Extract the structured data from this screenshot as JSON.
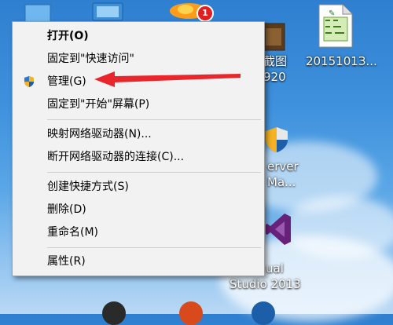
{
  "context_menu": {
    "items": [
      {
        "label": "打开(O)",
        "bold": true
      },
      {
        "label": "固定到\"快速访问\""
      },
      {
        "label": "管理(G)",
        "icon": "uac-shield-icon"
      },
      {
        "label": "固定到\"开始\"屏幕(P)"
      },
      {
        "label": "映射网络驱动器(N)..."
      },
      {
        "label": "断开网络驱动器的连接(C)..."
      },
      {
        "label": "创建快捷方式(S)"
      },
      {
        "label": "删除(D)"
      },
      {
        "label": "重命名(M)"
      },
      {
        "label": "属性(R)"
      }
    ]
  },
  "desktop": {
    "icons": [
      {
        "name": "image-file",
        "label_line1": "截图",
        "label_line2": "920"
      },
      {
        "name": "excel-file",
        "label_line1": "2015101З..."
      },
      {
        "name": "sql-server-manager",
        "label_line1": "erver",
        "label_line2": "Ma..."
      },
      {
        "name": "visual-studio-2013",
        "label_line1": "ual",
        "label_line2": "Studio 2013"
      }
    ],
    "badge_count": "1"
  },
  "colors": {
    "menu_bg": "#f2f2f2",
    "arrow_red": "#e8262b",
    "badge_red": "#e02020"
  }
}
